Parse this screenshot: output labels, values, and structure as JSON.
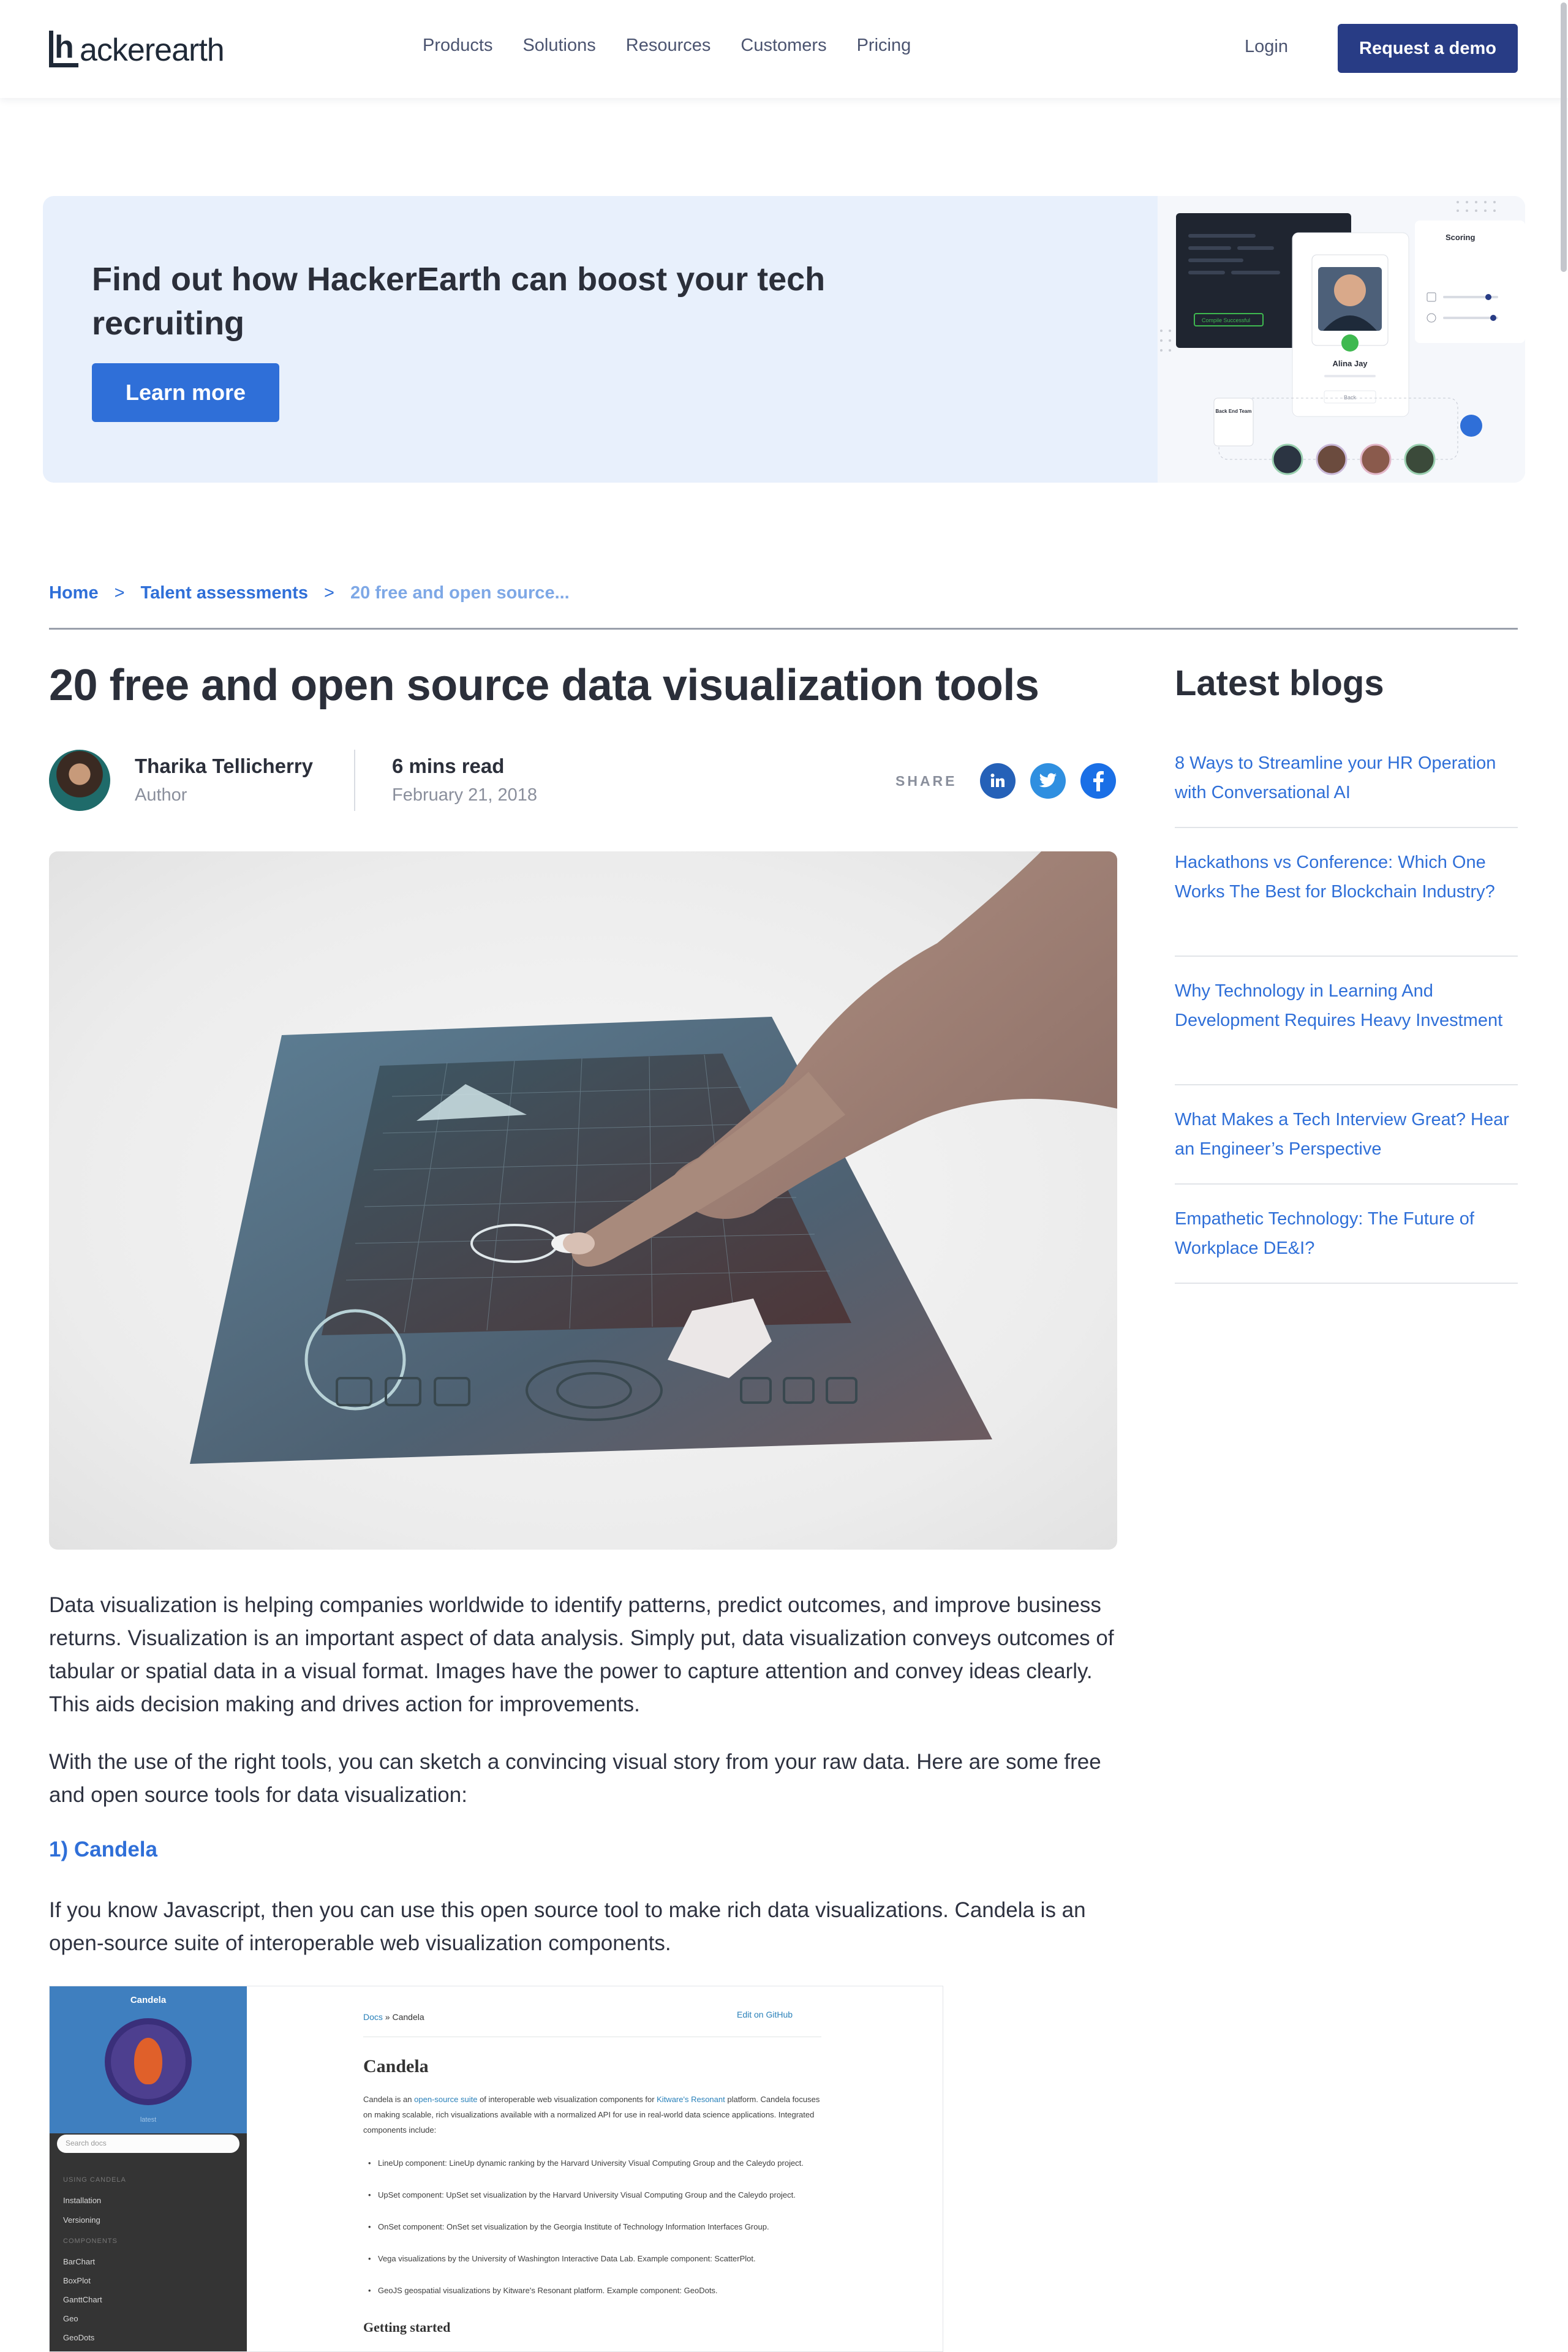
{
  "header": {
    "logo_text": "ackerearth",
    "nav": [
      "Products",
      "Solutions",
      "Resources",
      "Customers",
      "Pricing"
    ],
    "login": "Login",
    "demo_button": "Request a demo"
  },
  "banner": {
    "headline": "Find out how HackerEarth can boost your tech recruiting",
    "button": "Learn more",
    "art": {
      "scoring_label": "Scoring",
      "candidate_name": "Alina Jay",
      "back_label": "Back",
      "team_label": "Back End Team",
      "status_label": "Compile Successful"
    }
  },
  "breadcrumb": {
    "home": "Home",
    "category": "Talent assessments",
    "current": "20 free and open source...",
    "separator": ">"
  },
  "article": {
    "title": "20 free and open source data visualization tools",
    "author_name": "Tharika Tellicherry",
    "author_role": "Author",
    "read_time": "6 mins read",
    "date": "February 21, 2018",
    "share_label": "SHARE",
    "share_icons": [
      "linkedin-icon",
      "twitter-icon",
      "facebook-icon"
    ],
    "paragraph_1": "Data visualization is helping companies worldwide to identify patterns, predict outcomes, and improve business returns. Visualization is an important aspect of data analysis. Simply put, data visualization conveys outcomes of tabular or spatial data in a visual format. Images have the power to capture attention and convey ideas clearly. This aids decision making and drives action for improvements.",
    "paragraph_2": "With the use of the right tools, you can sketch a convincing visual story from your raw data. Here are some free and open source tools for data visualization:",
    "section_1_heading": "1) Candela",
    "paragraph_3": "If you know Javascript, then you can use this open source tool to make rich data visualizations. Candela is an open-source suite of interoperable web visualization components."
  },
  "candela_screenshot": {
    "brand": "Candela",
    "version": "latest",
    "search_placeholder": "Search docs",
    "nav_caption_1": "USING CANDELA",
    "nav_1": [
      "Installation",
      "Versioning"
    ],
    "nav_caption_2": "COMPONENTS",
    "nav_2": [
      "BarChart",
      "BoxPlot",
      "GanttChart",
      "Geo",
      "GeoDots"
    ],
    "crumb_link": "Docs",
    "crumb_rest": "» Candela",
    "edit_link": "Edit on GitHub",
    "heading": "Candela",
    "intro_a": "Candela is an ",
    "intro_link_1": "open-source suite",
    "intro_b": " of interoperable web visualization components for ",
    "intro_link_2": "Kitware's Resonant",
    "intro_c": " platform. Candela focuses on making scalable, rich visualizations available with a normalized API for use in real-world data science applications. Integrated components include:",
    "list": [
      "LineUp component: LineUp dynamic ranking by the Harvard University Visual Computing Group and the Caleydo project.",
      "UpSet component: UpSet set visualization by the Harvard University Visual Computing Group and the Caleydo project.",
      "OnSet component: OnSet set visualization by the Georgia Institute of Technology Information Interfaces Group.",
      "Vega visualizations by the University of Washington Interactive Data Lab. Example component: ScatterPlot.",
      "GeoJS geospatial visualizations by Kitware's Resonant platform. Example component: GeoDots."
    ],
    "subheading": "Getting started"
  },
  "sidebar": {
    "title": "Latest blogs",
    "items": [
      "8 Ways to Streamline your HR Operation with Conversational AI",
      "Hackathons vs Conference: Which One Works The Best for Blockchain Industry?",
      "Why Technology in Learning And Development Requires Heavy Investment",
      "What Makes a Tech Interview Great? Hear an Engineer’s Perspective",
      "Empathetic Technology: The Future of Workplace DE&I?"
    ]
  },
  "colors": {
    "brand_navy": "#283c85",
    "link_blue": "#2f6fd8",
    "banner_bg": "#e8f0fc",
    "linkedin": "#2561b8",
    "twitter": "#2f8fe0",
    "facebook": "#1a6fe6"
  }
}
